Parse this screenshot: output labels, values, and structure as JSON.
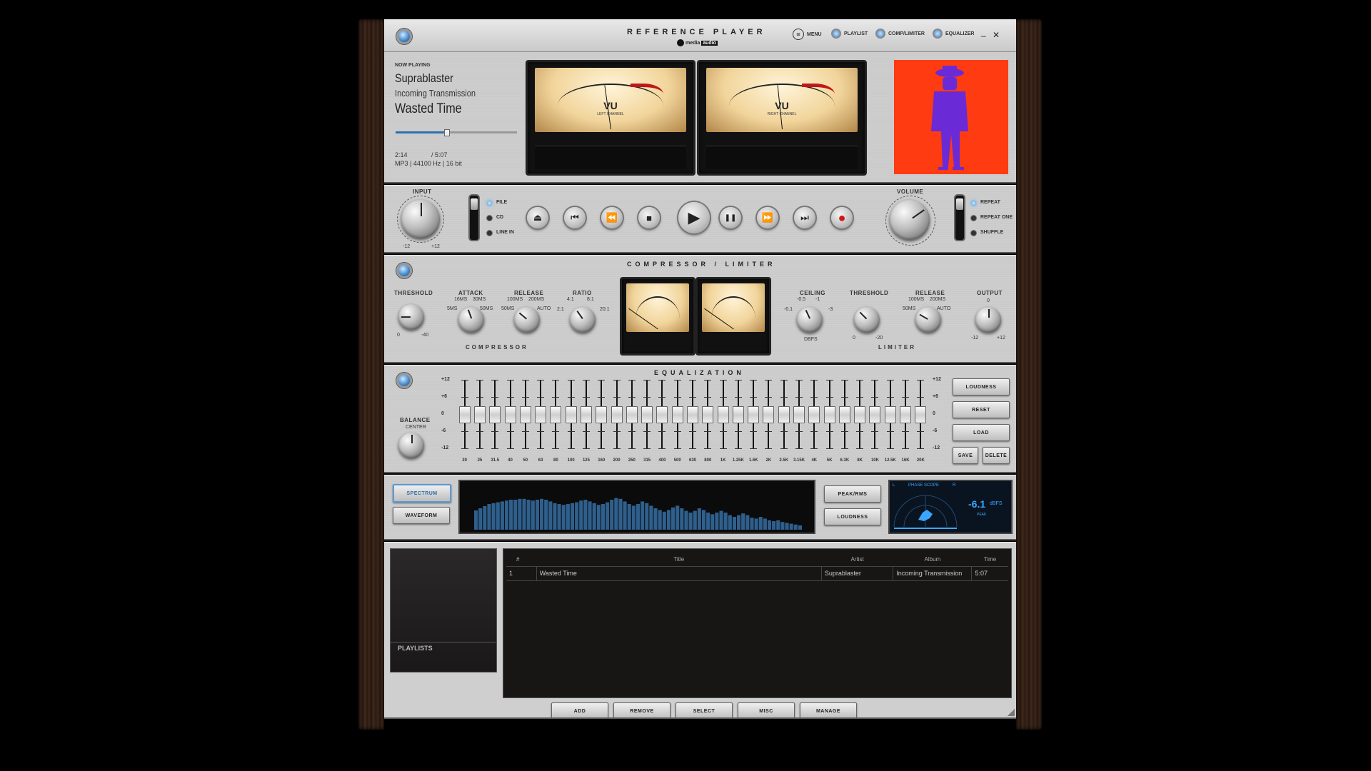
{
  "header": {
    "title": "REFERENCE PLAYER",
    "brand": "media",
    "brand_suffix": "audio",
    "nav": [
      {
        "label": "MENU",
        "icon": "menu-icon"
      },
      {
        "label": "PLAYLIST",
        "icon": "playlist-led-icon"
      },
      {
        "label": "COMP/LIMITER",
        "icon": "complimiter-led-icon"
      },
      {
        "label": "EQUALIZER",
        "icon": "equalizer-led-icon"
      }
    ],
    "minimize": "_",
    "close": "✕"
  },
  "now_playing": {
    "heading": "NOW PLAYING",
    "artist": "Suprablaster",
    "album": "Incoming Transmission",
    "track": "Wasted Time",
    "progress": 0.42,
    "elapsed": "2:14",
    "duration": "/ 5:07",
    "format": "MP3 | 44100 Hz | 16 bit"
  },
  "meters": {
    "vu_label": "VU",
    "left_label": "LEFT CHANNEL",
    "right_label": "RIGHT CHANNEL"
  },
  "transport": {
    "input_label": "INPUT",
    "input_min": "-12",
    "input_max": "+12",
    "sources": [
      {
        "label": "FILE",
        "active": true
      },
      {
        "label": "CD",
        "active": false
      },
      {
        "label": "LINE IN",
        "active": false
      }
    ],
    "buttons": [
      {
        "name": "eject-button",
        "glyph": "⏏"
      },
      {
        "name": "skip-back-button",
        "glyph": "⏮"
      },
      {
        "name": "rewind-button",
        "glyph": "⏪"
      },
      {
        "name": "stop-button",
        "glyph": "■"
      },
      {
        "name": "play-button",
        "glyph": "▶"
      },
      {
        "name": "pause-button",
        "glyph": "❚❚"
      },
      {
        "name": "fast-forward-button",
        "glyph": "⏩"
      },
      {
        "name": "skip-forward-button",
        "glyph": "⏭"
      },
      {
        "name": "record-button",
        "glyph": "●"
      }
    ],
    "volume_label": "VOLUME",
    "modes": [
      {
        "label": "REPEAT",
        "active": true
      },
      {
        "label": "REPEAT ONE",
        "active": false
      },
      {
        "label": "SHUFFLE",
        "active": false
      }
    ]
  },
  "compressor": {
    "section_title": "COMPRESSOR / LIMITER",
    "compressor_label": "COMPRESSOR",
    "limiter_label": "LIMITER",
    "threshold": {
      "label": "THRESHOLD",
      "min": "0",
      "max": "-40"
    },
    "attack": {
      "label": "ATTACK",
      "marks": [
        "16ms",
        "30ms",
        "5ms",
        "50ms"
      ]
    },
    "release": {
      "label": "RELEASE",
      "marks": [
        "100ms",
        "200ms",
        "50ms",
        "AUTO"
      ]
    },
    "ratio": {
      "label": "RATIO",
      "marks": [
        "4:1",
        "8:1",
        "2:1",
        "20:1"
      ]
    },
    "ceiling": {
      "label": "CEILING",
      "marks": [
        "-0.5",
        "-1",
        "-0.1",
        "-3",
        "dBFS"
      ]
    },
    "lim_threshold": {
      "label": "THRESHOLD",
      "min": "0",
      "max": "-20"
    },
    "lim_release": {
      "label": "RELEASE",
      "marks": [
        "100ms",
        "200ms",
        "50ms",
        "AUTO"
      ]
    },
    "output": {
      "label": "OUTPUT",
      "marks": [
        "0",
        "-12",
        "+12"
      ]
    }
  },
  "equalizer": {
    "section_title": "EQUALIZATION",
    "balance_label": "BALANCE",
    "balance_center": "CENTER",
    "scale": [
      "+12",
      "+6",
      "0",
      "-6",
      "-12"
    ],
    "bands": [
      "20",
      "25",
      "31.5",
      "40",
      "50",
      "63",
      "80",
      "100",
      "125",
      "160",
      "200",
      "250",
      "315",
      "400",
      "500",
      "630",
      "800",
      "1k",
      "1.25k",
      "1.6k",
      "2k",
      "2.5k",
      "3.15k",
      "4k",
      "5k",
      "6.3k",
      "8k",
      "10k",
      "12.5k",
      "16k",
      "20k"
    ],
    "buttons": {
      "loudness": "LOUDNESS",
      "reset": "RESET",
      "load": "LOAD",
      "save": "SAVE",
      "delete": "DELETE"
    }
  },
  "analyzer": {
    "spectrum": "SPECTRUM",
    "waveform": "WAVEFORM",
    "peak_rms": "PEAK/RMS",
    "loudness": "LOUDNESS",
    "phase_title": "PHASE SCOPE",
    "phase_l": "L",
    "phase_r": "R",
    "level": "-6.1",
    "level_unit": "dBFS",
    "level_sub": "PEAK",
    "spectrum_levels": [
      0.45,
      0.5,
      0.55,
      0.6,
      0.62,
      0.64,
      0.66,
      0.68,
      0.7,
      0.7,
      0.72,
      0.72,
      0.7,
      0.68,
      0.7,
      0.72,
      0.7,
      0.66,
      0.62,
      0.6,
      0.58,
      0.6,
      0.62,
      0.64,
      0.68,
      0.7,
      0.66,
      0.62,
      0.58,
      0.6,
      0.64,
      0.7,
      0.74,
      0.72,
      0.66,
      0.6,
      0.56,
      0.6,
      0.66,
      0.62,
      0.56,
      0.5,
      0.46,
      0.42,
      0.46,
      0.52,
      0.56,
      0.5,
      0.44,
      0.4,
      0.44,
      0.5,
      0.46,
      0.4,
      0.36,
      0.4,
      0.44,
      0.4,
      0.34,
      0.3,
      0.34,
      0.38,
      0.34,
      0.28,
      0.26,
      0.3,
      0.26,
      0.22,
      0.2,
      0.22,
      0.18,
      0.16,
      0.14,
      0.12,
      0.1
    ]
  },
  "playlist": {
    "sidebar_label": "PLAYLISTS",
    "columns": [
      "#",
      "Title",
      "Artist",
      "Album",
      "Time"
    ],
    "rows": [
      {
        "num": "1",
        "title": "Wasted Time",
        "artist": "Suprablaster",
        "album": "Incoming Transmission",
        "time": "5:07"
      }
    ],
    "footer_buttons": [
      "ADD",
      "REMOVE",
      "SELECT",
      "MISC",
      "MANAGE"
    ]
  },
  "colors": {
    "accent_blue": "#4a8fd0",
    "album_bg": "#ff3b12",
    "record_red": "#d21616",
    "meter_cyan": "#39a7ff"
  }
}
